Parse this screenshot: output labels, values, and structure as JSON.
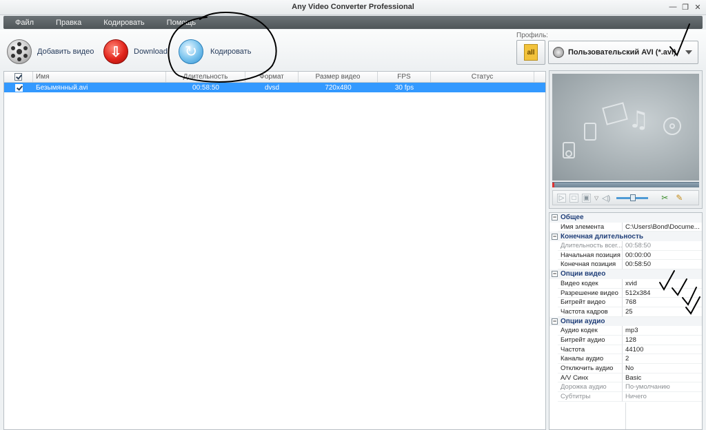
{
  "window": {
    "title": "Any Video Converter Professional"
  },
  "menu": [
    "Файл",
    "Правка",
    "Кодировать",
    "Помощь"
  ],
  "toolbar": {
    "add_video": "Добавить видео",
    "download": "Download",
    "encode": "Кодировать",
    "profile_label": "Профиль:",
    "profile_all": "all",
    "profile_value": "Пользовательский AVI (*.avi)"
  },
  "filelist": {
    "columns": [
      "Имя",
      "Длительность",
      "Формат",
      "Размер видео",
      "FPS",
      "Статус"
    ],
    "rows": [
      {
        "name": "Безымянный.avi",
        "duration": "00:58:50",
        "format": "dvsd",
        "size": "720x480",
        "fps": "30 fps",
        "status": ""
      }
    ]
  },
  "properties": {
    "general": {
      "title": "Общее",
      "rows": [
        {
          "name": "Имя элемента",
          "value": "C:\\Users\\Bond\\Docume..."
        }
      ]
    },
    "duration": {
      "title": "Конечная длительность",
      "rows": [
        {
          "name": "Длительность всег...",
          "value": "00:58:50"
        },
        {
          "name": "Начальная позиция",
          "value": "00:00:00"
        },
        {
          "name": "Конечная позиция",
          "value": "00:58:50"
        }
      ]
    },
    "video": {
      "title": "Опции видео",
      "rows": [
        {
          "name": "Видео кодек",
          "value": "xvid"
        },
        {
          "name": "Разрешение видео",
          "value": "512x384"
        },
        {
          "name": "Битрейт видео",
          "value": "768"
        },
        {
          "name": "Частота кадров",
          "value": "25"
        }
      ]
    },
    "audio": {
      "title": "Опции аудио",
      "rows": [
        {
          "name": "Аудио кодек",
          "value": "mp3"
        },
        {
          "name": "Битрейт аудио",
          "value": "128"
        },
        {
          "name": "Частота",
          "value": "44100"
        },
        {
          "name": "Каналы аудио",
          "value": "2"
        },
        {
          "name": "Отключить аудио",
          "value": "No"
        },
        {
          "name": "A/V Синх",
          "value": "Basic"
        },
        {
          "name": "Дорожка аудио",
          "value": "По-умолчанию"
        },
        {
          "name": "Субтитры",
          "value": "Ничего"
        }
      ]
    }
  }
}
